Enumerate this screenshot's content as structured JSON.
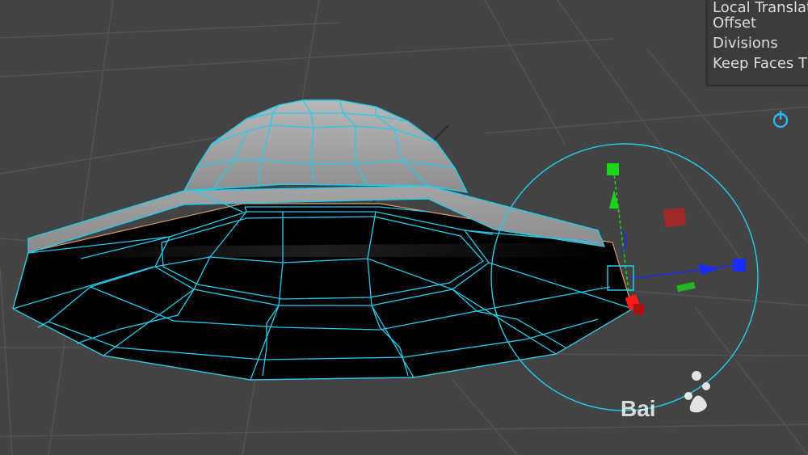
{
  "attribute_panel": {
    "rows": [
      {
        "label": "Local Translat"
      },
      {
        "label": "Offset"
      },
      {
        "label": "Divisions"
      },
      {
        "label": "Keep Faces T"
      }
    ]
  },
  "watermark": {
    "text": "Bai"
  },
  "colors": {
    "viewport_bg": "#434343",
    "grid_line": "#565656",
    "wireframe": "#22ccee",
    "face_dark": "#000000",
    "face_light": "#9a9a9a",
    "rim_edge": "#e39a62",
    "axis_x": "#1a2bff",
    "axis_y": "#19d619",
    "axis_z": "#ff1a1a",
    "panel_bg": "#3b3b3b",
    "panel_text": "#dcdcdc",
    "icon_accent": "#29b6f6"
  }
}
